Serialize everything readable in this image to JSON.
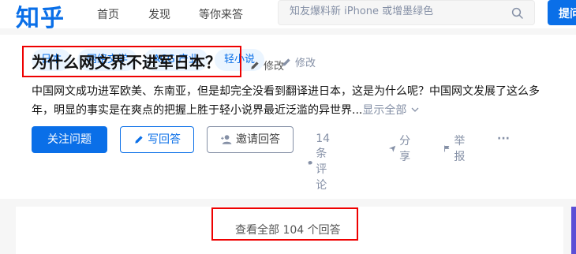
{
  "header": {
    "logo": "知乎",
    "nav": [
      "首页",
      "发现",
      "等你来答"
    ],
    "search_placeholder": "知友爆料新 iPhone 或增墨绿色",
    "ask_label": "提问"
  },
  "question": {
    "topics": [
      "日本",
      "网络文学",
      "ACG 产业",
      "轻小说"
    ],
    "topics_edit": "修改",
    "title": "为什么网文界不进军日本？",
    "title_edit": "修改",
    "description": "中国网文成功进军欧美、东南亚，但是却完全没看到翻译进日本，这是为什么呢？中国网文发展了这么多年，明显的事实是在爽点的把握上胜于轻小说界最近泛滥的异世界...",
    "show_all": "显示全部"
  },
  "actions": {
    "follow": "关注问题",
    "write": "写回答",
    "invite": "邀请回答",
    "comments": "14 条评论",
    "share": "分享",
    "report": "举报",
    "more": "···"
  },
  "answers": {
    "view_all": "查看全部 104 个回答"
  },
  "colors": {
    "brand": "#0a6fe8",
    "highlight_box": "#e00000"
  }
}
